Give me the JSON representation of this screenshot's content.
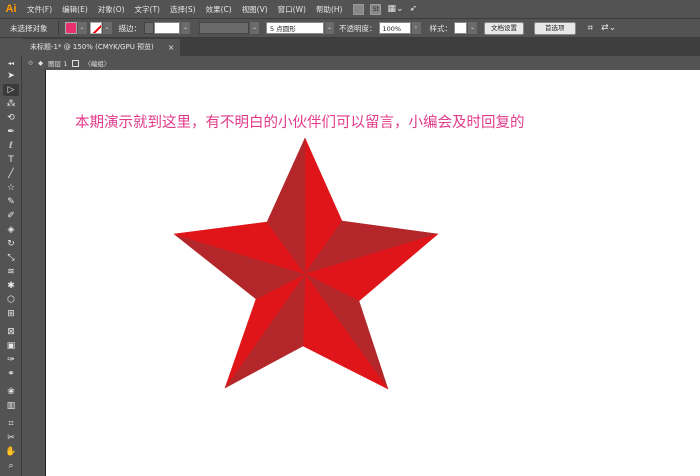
{
  "app": {
    "logo": "Ai"
  },
  "menu": [
    "文件(F)",
    "编辑(E)",
    "对象(O)",
    "文字(T)",
    "选择(S)",
    "效果(C)",
    "视图(V)",
    "窗口(W)",
    "帮助(H)"
  ],
  "menu_right": {
    "st_label": "St"
  },
  "control_bar": {
    "selection_label": "未选择对象",
    "stroke_label": "描边：",
    "brush_value": "5 点圆形",
    "opacity_label": "不透明度：",
    "opacity_value": "100%",
    "style_label": "样式：",
    "doc_setup_button": "文档设置",
    "preferences_button": "首选项",
    "fill_color": "#e8306e"
  },
  "document_tab": {
    "title": "未标题-1* @ 150% (CMYK/GPU 预览)",
    "close": "×"
  },
  "breadcrumb": {
    "layer": "图层 1",
    "mode": "〈编组〉"
  },
  "artboard": {
    "caption": "本期演示就到这里，有不明白的小伙伴们可以留言，小编会及时回复的",
    "caption_color": "#e23a8a",
    "star_colors": {
      "light": "#e01519",
      "dark": "#b3262a"
    }
  }
}
